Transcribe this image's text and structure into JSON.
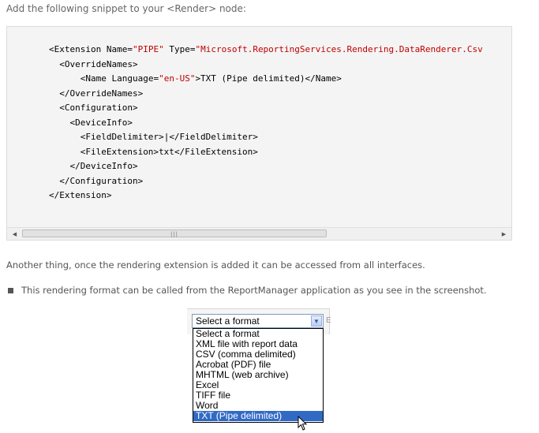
{
  "intro_text": "Add the following snippet to your <Render> node:",
  "code": {
    "lines": [
      {
        "indent": "        ",
        "parts": [
          {
            "t": "<Extension ",
            "c": "tag"
          },
          {
            "t": "Name=",
            "c": "attr"
          },
          {
            "t": "\"PIPE\"",
            "c": "val"
          },
          {
            "t": " Type=",
            "c": "attr"
          },
          {
            "t": "\"Microsoft.ReportingServices.Rendering.DataRenderer.Csv",
            "c": "val"
          }
        ]
      },
      {
        "indent": "          ",
        "parts": [
          {
            "t": "<OverrideNames>",
            "c": "tag"
          }
        ]
      },
      {
        "indent": "              ",
        "parts": [
          {
            "t": "<Name ",
            "c": "tag"
          },
          {
            "t": "Language=",
            "c": "attr"
          },
          {
            "t": "\"en-US\"",
            "c": "val"
          },
          {
            "t": ">TXT (Pipe delimited)</Name>",
            "c": "tag"
          }
        ]
      },
      {
        "indent": "          ",
        "parts": [
          {
            "t": "</OverrideNames>",
            "c": "tag"
          }
        ]
      },
      {
        "indent": "          ",
        "parts": [
          {
            "t": "<Configuration>",
            "c": "tag"
          }
        ]
      },
      {
        "indent": "            ",
        "parts": [
          {
            "t": "<DeviceInfo>",
            "c": "tag"
          }
        ]
      },
      {
        "indent": "              ",
        "parts": [
          {
            "t": "<FieldDelimiter>",
            "c": "tag"
          },
          {
            "t": "|",
            "c": "txt"
          },
          {
            "t": "</FieldDelimiter>",
            "c": "tag"
          }
        ]
      },
      {
        "indent": "              ",
        "parts": [
          {
            "t": "<FileExtension>",
            "c": "tag"
          },
          {
            "t": "txt",
            "c": "txt"
          },
          {
            "t": "</FileExtension>",
            "c": "tag"
          }
        ]
      },
      {
        "indent": "            ",
        "parts": [
          {
            "t": "</DeviceInfo>",
            "c": "tag"
          }
        ]
      },
      {
        "indent": "          ",
        "parts": [
          {
            "t": "</Configuration>",
            "c": "tag"
          }
        ]
      },
      {
        "indent": "        ",
        "parts": [
          {
            "t": "</Extension>",
            "c": "tag"
          }
        ]
      }
    ]
  },
  "scrollbar": {
    "left_arrow": "◀",
    "right_arrow": "▶",
    "grip": "|||"
  },
  "paragraph": "Another thing, once the rendering extension is added it can be accessed from all interfaces.",
  "bullet": "This rendering format can be called from the ReportManager application as you see in the screenshot.",
  "screenshot": {
    "select_value": "Select a format",
    "edge_char": "E",
    "dropdown_arrow": "▼",
    "options": [
      "Select a format",
      "XML file with report data",
      "CSV (comma delimited)",
      "Acrobat (PDF) file",
      "MHTML (web archive)",
      "Excel",
      "TIFF file",
      "Word",
      "TXT (Pipe delimited)"
    ],
    "selected_index": 8
  }
}
